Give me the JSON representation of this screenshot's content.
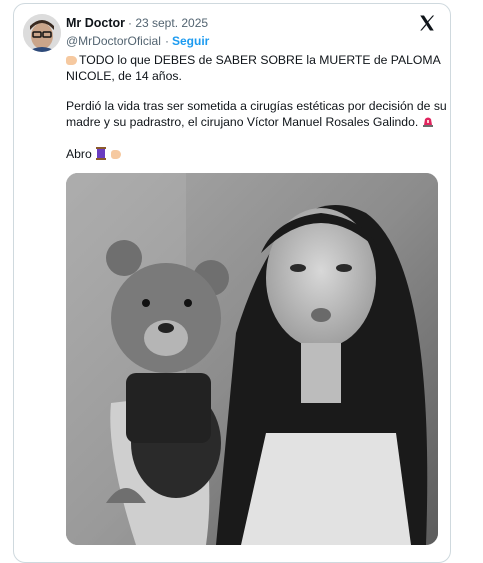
{
  "tweet": {
    "author_name": "Mr Doctor",
    "date": "· 23 sept. 2025",
    "handle": "@MrDoctorOficial",
    "dot": "·",
    "follow_label": "Seguir",
    "line1": "TODO lo que DEBES de SABER SOBRE la MUERTE de PALOMA",
    "line2": "NICOLE, de 14 años.",
    "line3": "Perdió la vida tras ser sometida a cirugías estéticas por decisión de su",
    "line4": "madre y su padrastro, el cirujano Víctor Manuel Rosales Galindo.",
    "line5": "Abro"
  },
  "icons": [
    "x-logo-icon",
    "pointing-hand-icon",
    "siren-icon",
    "spool-icon"
  ],
  "colors": {
    "link": "#1d9bf0",
    "muted": "#536471",
    "text": "#0f1419",
    "border": "#cfd9de"
  }
}
